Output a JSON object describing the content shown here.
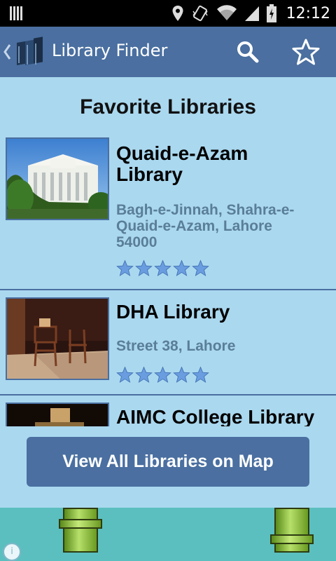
{
  "status_bar": {
    "time": "12:12",
    "icons": [
      "location-icon",
      "vibrate-icon",
      "wifi-icon",
      "signal-icon",
      "battery-icon"
    ]
  },
  "action_bar": {
    "title": "Library Finder",
    "icons": [
      "back-chevron-icon",
      "books-logo-icon",
      "search-icon",
      "star-icon"
    ]
  },
  "page": {
    "heading": "Favorite Libraries"
  },
  "libraries": [
    {
      "name_line1": "Quaid-e-Azam",
      "name_line2": "Library",
      "address_line1": "Bagh-e-Jinnah, Shahra-e-",
      "address_line2": "Quaid-e-Azam, Lahore",
      "address_line3": "54000",
      "rating": 5
    },
    {
      "name_line1": "DHA Library",
      "address_line1": "Street 38, Lahore",
      "rating": 5
    },
    {
      "name_line1": "AIMC College Library"
    }
  ],
  "map_button": {
    "label": "View All Libraries on Map"
  },
  "ad": {
    "info_glyph": "i"
  },
  "colors": {
    "action_bar": "#4a6fa0",
    "content_bg": "#aad8ef",
    "address_text": "#5a7e98",
    "star": "#6a9de0"
  }
}
